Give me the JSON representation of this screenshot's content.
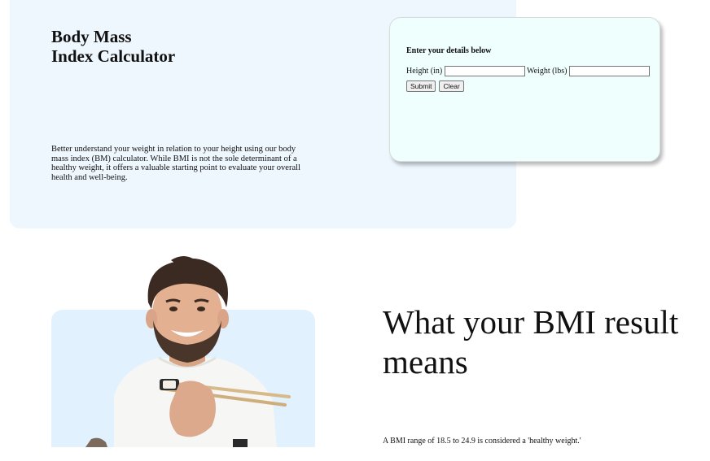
{
  "hero": {
    "title_line1": "Body Mass",
    "title_line2": "Index Calculator",
    "description": "Better understand your weight in relation to your height using our body mass index (BM) calculator. While BMI is not the sole determinant of a healthy weight, it offers a valuable starting point to evaluate your overall health and well-being."
  },
  "calculator": {
    "heading": "Enter your details below",
    "height_label": "Height (in)",
    "height_value": "",
    "weight_label": "Weight (lbs)",
    "weight_value": "",
    "submit_label": "Submit",
    "clear_label": "Clear"
  },
  "result_section": {
    "title": "What your BMI result means",
    "text": "A BMI range of 18.5 to 24.9 is considered a 'healthy weight.'"
  },
  "colors": {
    "hero_bg": "#eef6fe",
    "card_bg": "#eefffe",
    "photo_bg": "#e1f1fd"
  }
}
